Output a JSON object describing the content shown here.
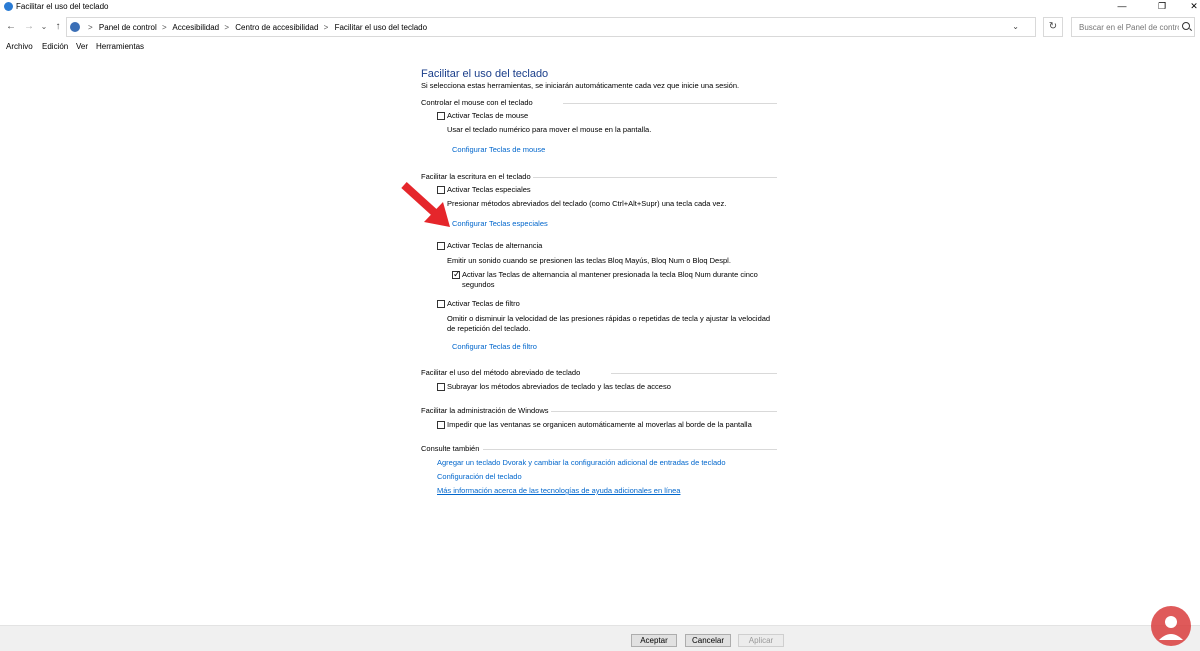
{
  "window": {
    "title": "Facilitar el uso del teclado",
    "controls": [
      "—",
      "❐",
      "✕"
    ]
  },
  "nav": {
    "back": "←",
    "forward": "→",
    "up": "↑",
    "dropdown": "⌄"
  },
  "address": {
    "crumbs": [
      "Panel de control",
      "Accesibilidad",
      "Centro de accesibilidad",
      "Facilitar el uso del teclado"
    ],
    "separator": ">",
    "dropdown": "⌄",
    "refresh": "↻"
  },
  "search": {
    "placeholder": "Buscar en el Panel de control"
  },
  "menu": [
    "Archivo",
    "Edición",
    "Ver",
    "Herramientas"
  ],
  "page": {
    "title": "Facilitar el uso del teclado",
    "subtitle": "Si selecciona estas herramientas, se iniciarán automáticamente cada vez que inicie una sesión."
  },
  "sections": {
    "mouse": {
      "heading": "Controlar el mouse con el teclado",
      "mouse_keys": {
        "label": "Activar Teclas de mouse",
        "checked": false
      },
      "description": "Usar el teclado numérico para mover el mouse en la pantalla.",
      "link": "Configurar Teclas de mouse"
    },
    "typing": {
      "heading": "Facilitar la escritura en el teclado",
      "sticky_keys": {
        "label": "Activar Teclas especiales",
        "checked": false
      },
      "sticky_desc": "Presionar métodos abreviados del teclado (como Ctrl+Alt+Supr) una tecla cada vez.",
      "sticky_link": "Configurar Teclas especiales",
      "toggle_keys": {
        "label": "Activar Teclas de alternancia",
        "checked": false
      },
      "toggle_desc": "Emitir un sonido cuando se presionen las teclas Bloq Mayús, Bloq Num o Bloq Despl.",
      "toggle_hold": {
        "label": "Activar las Teclas de alternancia al mantener presionada la tecla Bloq Num durante cinco segundos",
        "checked": true
      },
      "filter_keys": {
        "label": "Activar Teclas de filtro",
        "checked": false
      },
      "filter_desc": "Omitir o disminuir la velocidad de las presiones rápidas o repetidas de tecla y ajustar la velocidad de repetición del teclado.",
      "filter_link": "Configurar Teclas de filtro"
    },
    "shortcuts": {
      "heading": "Facilitar el uso del método abreviado de teclado",
      "underline": {
        "label": "Subrayar los métodos abreviados de teclado y las teclas de acceso",
        "checked": false
      }
    },
    "windows": {
      "heading": "Facilitar la administración de Windows",
      "snap": {
        "label": "Impedir que las ventanas se organicen automáticamente al moverlas al borde de la pantalla",
        "checked": false
      }
    },
    "see_also": {
      "heading": "Consulte también",
      "links": [
        "Agregar un teclado Dvorak y cambiar la configuración adicional de entradas de teclado",
        "Configuración del teclado",
        "Más información acerca de las tecnologías de ayuda adicionales en línea"
      ]
    }
  },
  "buttons": {
    "accept": "Aceptar",
    "cancel": "Cancelar",
    "apply": "Aplicar"
  },
  "colors": {
    "title_blue": "#1a3e8a",
    "link_blue": "#0066cc",
    "arrow_red": "#e5262b"
  }
}
